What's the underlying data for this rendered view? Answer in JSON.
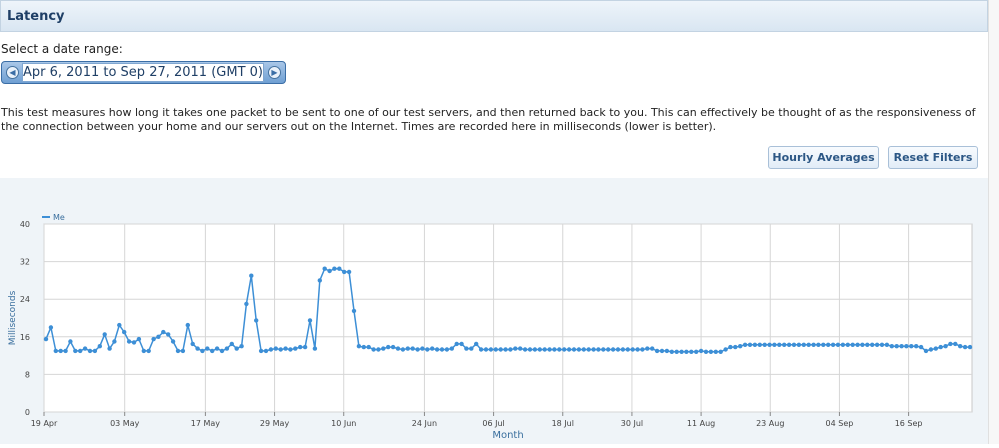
{
  "panel": {
    "title": "Latency"
  },
  "date_range": {
    "label": "Select a date range:",
    "value": "Apr 6, 2011 to Sep 27, 2011 (GMT 0)",
    "prev_icon": "chevron-left-icon",
    "next_icon": "chevron-right-icon"
  },
  "description": "This test measures how long it takes one packet to be sent to one of our test servers, and then returned back to you. This can effectively be thought of as the responsiveness of the connection between your home and our servers out on the Internet. Times are recorded here in milliseconds (lower is better).",
  "buttons": {
    "hourly": "Hourly Averages",
    "reset": "Reset Filters"
  },
  "colors": {
    "series": "#3d8fd6",
    "axis_text": "#3a6f9e",
    "grid": "#d6d6d6"
  },
  "chart_data": {
    "type": "line",
    "title": "",
    "xlabel": "Month",
    "ylabel": "Milliseconds",
    "ylim": [
      0,
      40
    ],
    "yticks": [
      0,
      8,
      16,
      24,
      32,
      40
    ],
    "x_start": "2011-04-19",
    "x_end": "2011-09-27",
    "xticks": [
      "19 Apr",
      "03 May",
      "17 May",
      "29 May",
      "10 Jun",
      "24 Jun",
      "06 Jul",
      "18 Jul",
      "30 Jul",
      "11 Aug",
      "23 Aug",
      "04 Sep",
      "16 Sep"
    ],
    "grid": true,
    "legend": "top-left",
    "series": [
      {
        "name": "Me",
        "values": [
          15.5,
          18,
          13,
          13,
          13,
          15,
          13,
          13,
          13.5,
          13,
          13,
          14,
          16.5,
          13.5,
          15,
          18.5,
          17,
          15,
          14.8,
          15.5,
          13,
          13,
          15.5,
          16,
          17,
          16.5,
          15,
          13,
          13,
          18.5,
          14.5,
          13.5,
          13,
          13.5,
          13,
          13.5,
          13,
          13.5,
          14.5,
          13.5,
          14,
          23,
          29,
          19.5,
          13,
          13,
          13.3,
          13.5,
          13.3,
          13.5,
          13.3,
          13.5,
          13.8,
          13.8,
          19.5,
          13.5,
          28,
          30.5,
          30,
          30.5,
          30.5,
          29.8,
          29.8,
          21.5,
          14,
          13.8,
          13.8,
          13.3,
          13.3,
          13.5,
          13.8,
          13.8,
          13.5,
          13.3,
          13.5,
          13.5,
          13.3,
          13.5,
          13.3,
          13.5,
          13.3,
          13.3,
          13.3,
          13.5,
          14.5,
          14.5,
          13.5,
          13.5,
          14.5,
          13.3,
          13.3,
          13.3,
          13.3,
          13.3,
          13.3,
          13.3,
          13.5,
          13.5,
          13.3,
          13.3,
          13.3,
          13.3,
          13.3,
          13.3,
          13.3,
          13.3,
          13.3,
          13.3,
          13.3,
          13.3,
          13.3,
          13.3,
          13.3,
          13.3,
          13.3,
          13.3,
          13.3,
          13.3,
          13.3,
          13.3,
          13.3,
          13.3,
          13.3,
          13.5,
          13.5,
          13,
          13,
          13,
          12.8,
          12.8,
          12.8,
          12.8,
          12.8,
          12.8,
          13,
          12.8,
          12.8,
          12.8,
          12.8,
          13.3,
          13.8,
          13.8,
          14,
          14.3,
          14.3,
          14.3,
          14.3,
          14.3,
          14.3,
          14.3,
          14.3,
          14.3,
          14.3,
          14.3,
          14.3,
          14.3,
          14.3,
          14.3,
          14.3,
          14.3,
          14.3,
          14.3,
          14.3,
          14.3,
          14.3,
          14.3,
          14.3,
          14.3,
          14.3,
          14.3,
          14.3,
          14.3,
          14.3,
          14,
          14,
          14,
          14,
          14,
          14,
          13.8,
          13,
          13.3,
          13.5,
          13.8,
          14,
          14.5,
          14.5,
          14,
          13.8,
          13.8
        ]
      }
    ]
  }
}
